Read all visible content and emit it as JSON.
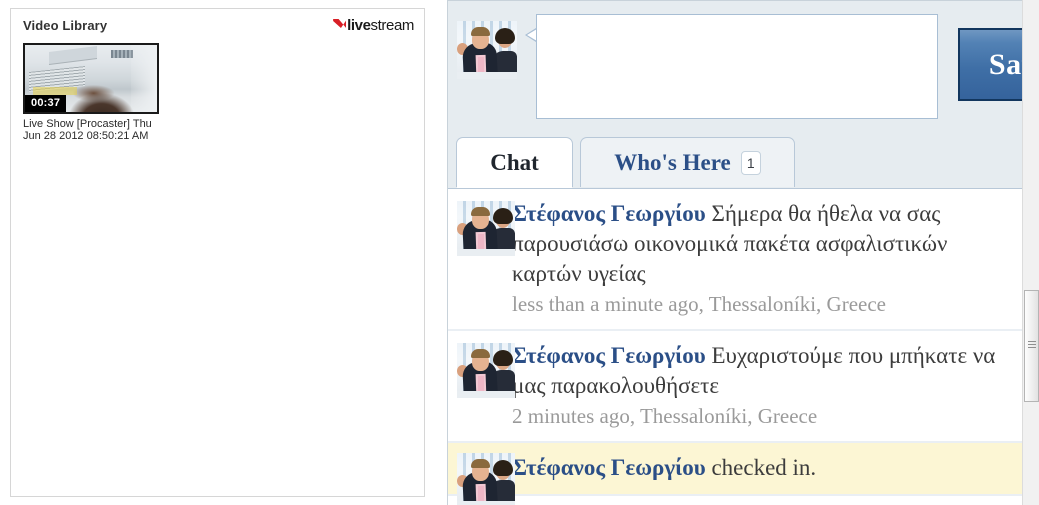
{
  "library": {
    "title": "Video Library",
    "logo": {
      "bold": "live",
      "light": "stream",
      "mark": "livestream-chevron-icon"
    },
    "video": {
      "duration": "00:37",
      "caption": "Live Show [Procaster] Thu Jun 28 2012 08:50:21 AM"
    }
  },
  "composer": {
    "input_value": "",
    "input_placeholder": "",
    "say_label": "Say",
    "avatar": "user-avatar"
  },
  "tabs": [
    {
      "label": "Chat",
      "active": true,
      "badge": null
    },
    {
      "label": "Who's Here",
      "active": false,
      "badge": "1"
    }
  ],
  "messages": [
    {
      "author": "Στέφανος Γεωργίου",
      "text": " Σήμερα θα ήθελα να σας παρουσιάσω οικονομικά πακέτα ασφαλιστικών καρτών υγείας",
      "meta": "less than a minute ago, Thessaloníki, Greece",
      "highlight": false
    },
    {
      "author": "Στέφανος Γεωργίου",
      "text": " Ευχαριστούμε που μπήκατε να μας παρακολουθήσετε",
      "meta": "2 minutes ago, Thessaloníki, Greece",
      "highlight": false
    },
    {
      "author": "Στέφανος Γεωργίου",
      "text": " checked in.",
      "meta": "",
      "highlight": true
    }
  ],
  "colors": {
    "accent_blue": "#2b4f87",
    "say_button": "#3f6fa6",
    "logo_red": "#d81f26",
    "highlight_row": "#fcf6d4",
    "panel_bg": "#e6ecf0"
  }
}
